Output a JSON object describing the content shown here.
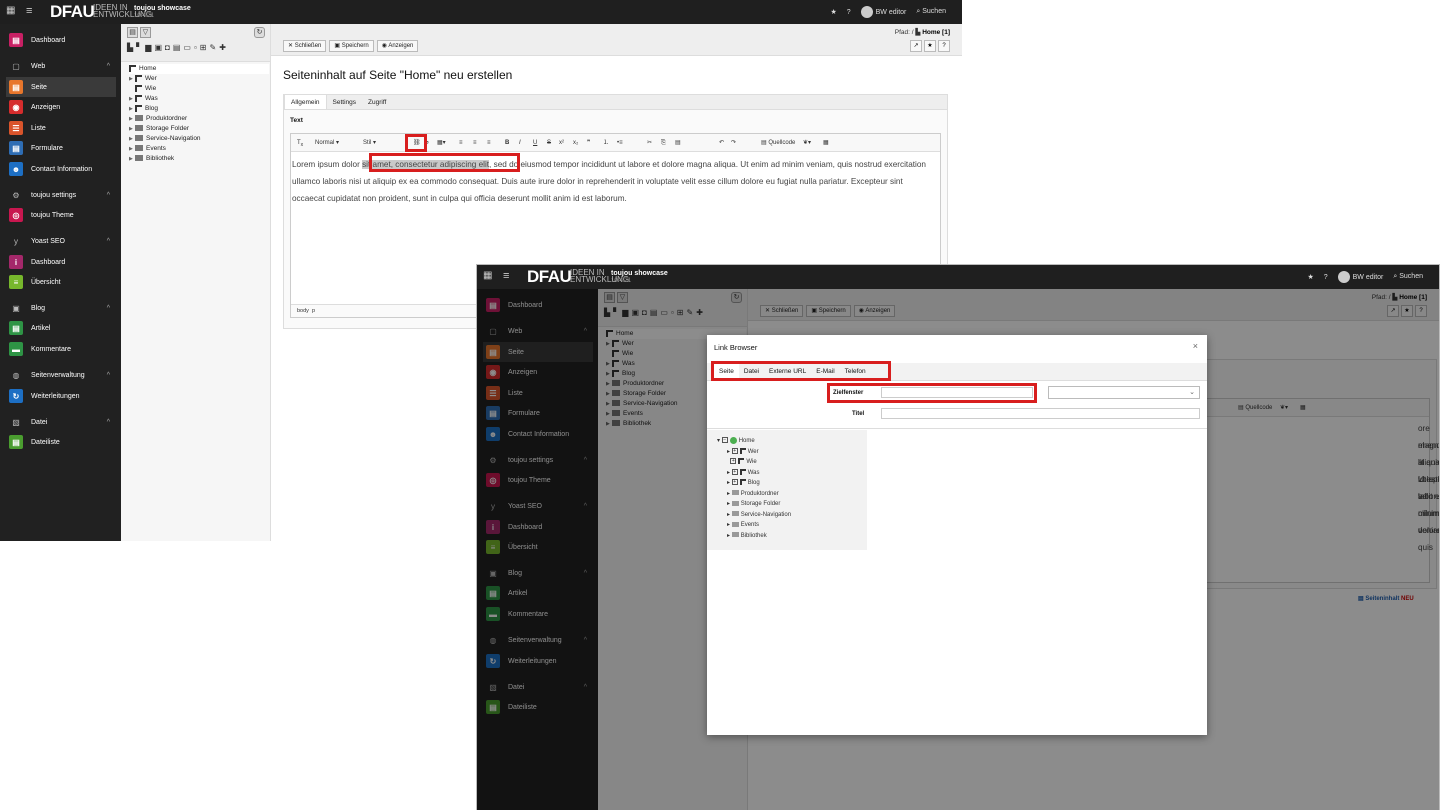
{
  "topbar": {
    "logo": "DFAU",
    "logo_sub": "IDEEN IN ENTWICKLUNG",
    "site_name": "toujou showcase",
    "site_version": "10.4.21",
    "star_icon": "★",
    "help_icon": "?",
    "user": "BW editor",
    "search": "Suchen"
  },
  "sidebar": {
    "dashboard": "Dashboard",
    "web": "Web",
    "seite": "Seite",
    "anzeigen": "Anzeigen",
    "liste": "Liste",
    "formulare": "Formulare",
    "contact": "Contact Information",
    "toujou_settings": "toujou settings",
    "toujou_theme": "toujou Theme",
    "yoast": "Yoast SEO",
    "yoast_dashboard": "Dashboard",
    "uebersicht": "Übersicht",
    "blog": "Blog",
    "artikel": "Artikel",
    "kommentare": "Kommentare",
    "seitenverwaltung": "Seitenverwaltung",
    "weiterleitungen": "Weiterleitungen",
    "datei": "Datei",
    "dateiliste": "Dateiliste",
    "colors": {
      "dashboard": "#c82064",
      "seite": "#e8762c",
      "anzeigen": "#d62d2d",
      "liste": "#d9542b",
      "formulare": "#2e6db4",
      "contact": "#1d6fc4",
      "theme": "#c8174f",
      "yoast_dash": "#a4286a",
      "uebersicht": "#77b72c",
      "artikel": "#2e9445",
      "kommentare": "#2e9445",
      "weiterleitungen": "#1d6fc4",
      "dateiliste": "#4a9d2f"
    }
  },
  "tree": {
    "home": "Home",
    "wer": "Wer",
    "wie": "Wie",
    "was": "Was",
    "blog": "Blog",
    "produktordner": "Produktordner",
    "storage": "Storage Folder",
    "service": "Service-Navigation",
    "events": "Events",
    "bibliothek": "Bibliothek"
  },
  "main": {
    "pfad_label": "Pfad: /",
    "pfad_page": "Home [1]",
    "btn_schliessen": "Schließen",
    "btn_speichern": "Speichern",
    "btn_anzeigen": "Anzeigen",
    "title": "Seiteninhalt auf Seite \"Home\" neu erstellen",
    "tab_allgemein": "Allgemein",
    "tab_settings": "Settings",
    "tab_zugriff": "Zugriff",
    "field_text": "Text",
    "format_normal": "Normal",
    "format_stil": "Stil",
    "quellcode": "Quellcode",
    "text_before": "Lorem ipsum dolor ",
    "text_highlight": "sit amet, consectetur adipiscing elit",
    "text_after": ", sed do eiusmod tempor incididunt ut labore et dolore magna aliqua. Ut enim ad minim veniam, quis nostrud exercitation ullamco laboris nisi ut aliquip ex ea commodo consequat. Duis aute irure dolor in reprehenderit in voluptate velit esse cillum dolore eu fugiat nulla pariatur. Excepteur sint occaecat cupidatat non proident, sunt in culpa qui officia deserunt mollit anim id est laborum.",
    "status_body": "body",
    "status_p": "p"
  },
  "shot2": {
    "visible_line1": "ore magna aliqua. Ut enim ad minim veniam, quis",
    "visible_line2": "ehenderit in voluptate velit esse cillum dolore eu",
    "visible_line3": "lit anim id est laborum.",
    "seiteninhalt_link": "Seiteninhalt",
    "neu": "NEU"
  },
  "modal": {
    "title": "Link Browser",
    "close": "×",
    "tab_seite": "Seite",
    "tab_datei": "Datei",
    "tab_externe": "Externe URL",
    "tab_email": "E-Mail",
    "tab_telefon": "Telefon",
    "label_zielfenster": "Zielfenster",
    "label_titel": "Titel",
    "select_chevron": "⌄"
  }
}
